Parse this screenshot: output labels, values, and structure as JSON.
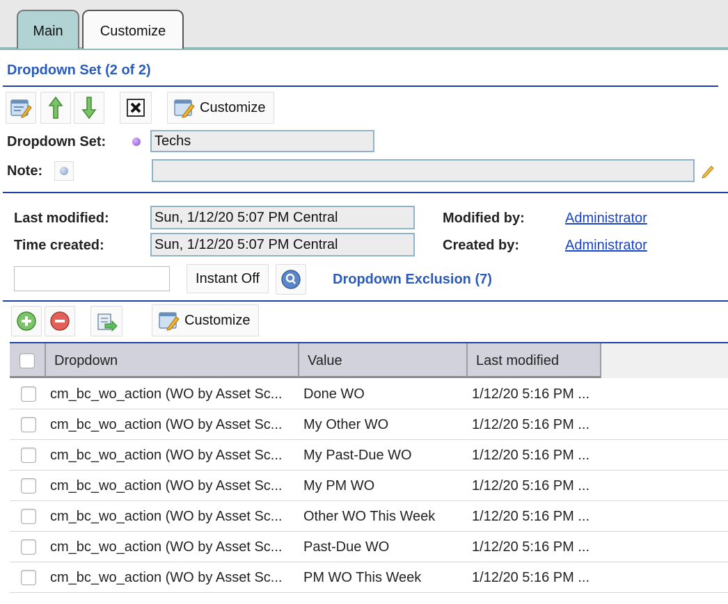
{
  "tabs": [
    {
      "label": "Main",
      "active": true
    },
    {
      "label": "Customize",
      "active": false
    }
  ],
  "dropdown_set_section": {
    "title": "Dropdown Set (2 of 2)",
    "toolbar": {
      "customize_label": "Customize"
    },
    "fields": {
      "dropdown_set_label": "Dropdown Set:",
      "dropdown_set_value": "Techs",
      "note_label": "Note:",
      "note_value": ""
    }
  },
  "meta": {
    "last_modified_label": "Last modified:",
    "last_modified_value": "Sun, 1/12/20 5:07 PM Central",
    "time_created_label": "Time created:",
    "time_created_value": "Sun, 1/12/20 5:07 PM Central",
    "modified_by_label": "Modified by:",
    "modified_by_value": "Administrator",
    "created_by_label": "Created by:",
    "created_by_value": "Administrator"
  },
  "exclusion": {
    "search_value": "",
    "instant_label": "Instant Off",
    "title": "Dropdown Exclusion (7)",
    "toolbar": {
      "customize_label": "Customize"
    },
    "columns": [
      "Dropdown",
      "Value",
      "Last modified"
    ],
    "rows": [
      {
        "dropdown": "cm_bc_wo_action (WO by Asset Sc...",
        "value": "Done WO",
        "modified": "1/12/20 5:16 PM ..."
      },
      {
        "dropdown": "cm_bc_wo_action (WO by Asset Sc...",
        "value": "My Other WO",
        "modified": "1/12/20 5:16 PM ..."
      },
      {
        "dropdown": "cm_bc_wo_action (WO by Asset Sc...",
        "value": "My Past-Due WO",
        "modified": "1/12/20 5:16 PM ..."
      },
      {
        "dropdown": "cm_bc_wo_action (WO by Asset Sc...",
        "value": "My PM WO",
        "modified": "1/12/20 5:16 PM ..."
      },
      {
        "dropdown": "cm_bc_wo_action (WO by Asset Sc...",
        "value": "Other WO This Week",
        "modified": "1/12/20 5:16 PM ..."
      },
      {
        "dropdown": "cm_bc_wo_action (WO by Asset Sc...",
        "value": "Past-Due WO",
        "modified": "1/12/20 5:16 PM ..."
      },
      {
        "dropdown": "cm_bc_wo_action (WO by Asset Sc...",
        "value": "PM WO This Week",
        "modified": "1/12/20 5:16 PM ..."
      }
    ]
  },
  "colors": {
    "accent_blue": "#2a5bb8",
    "tab_active": "#b2d3d3",
    "link": "#1a44c8"
  }
}
